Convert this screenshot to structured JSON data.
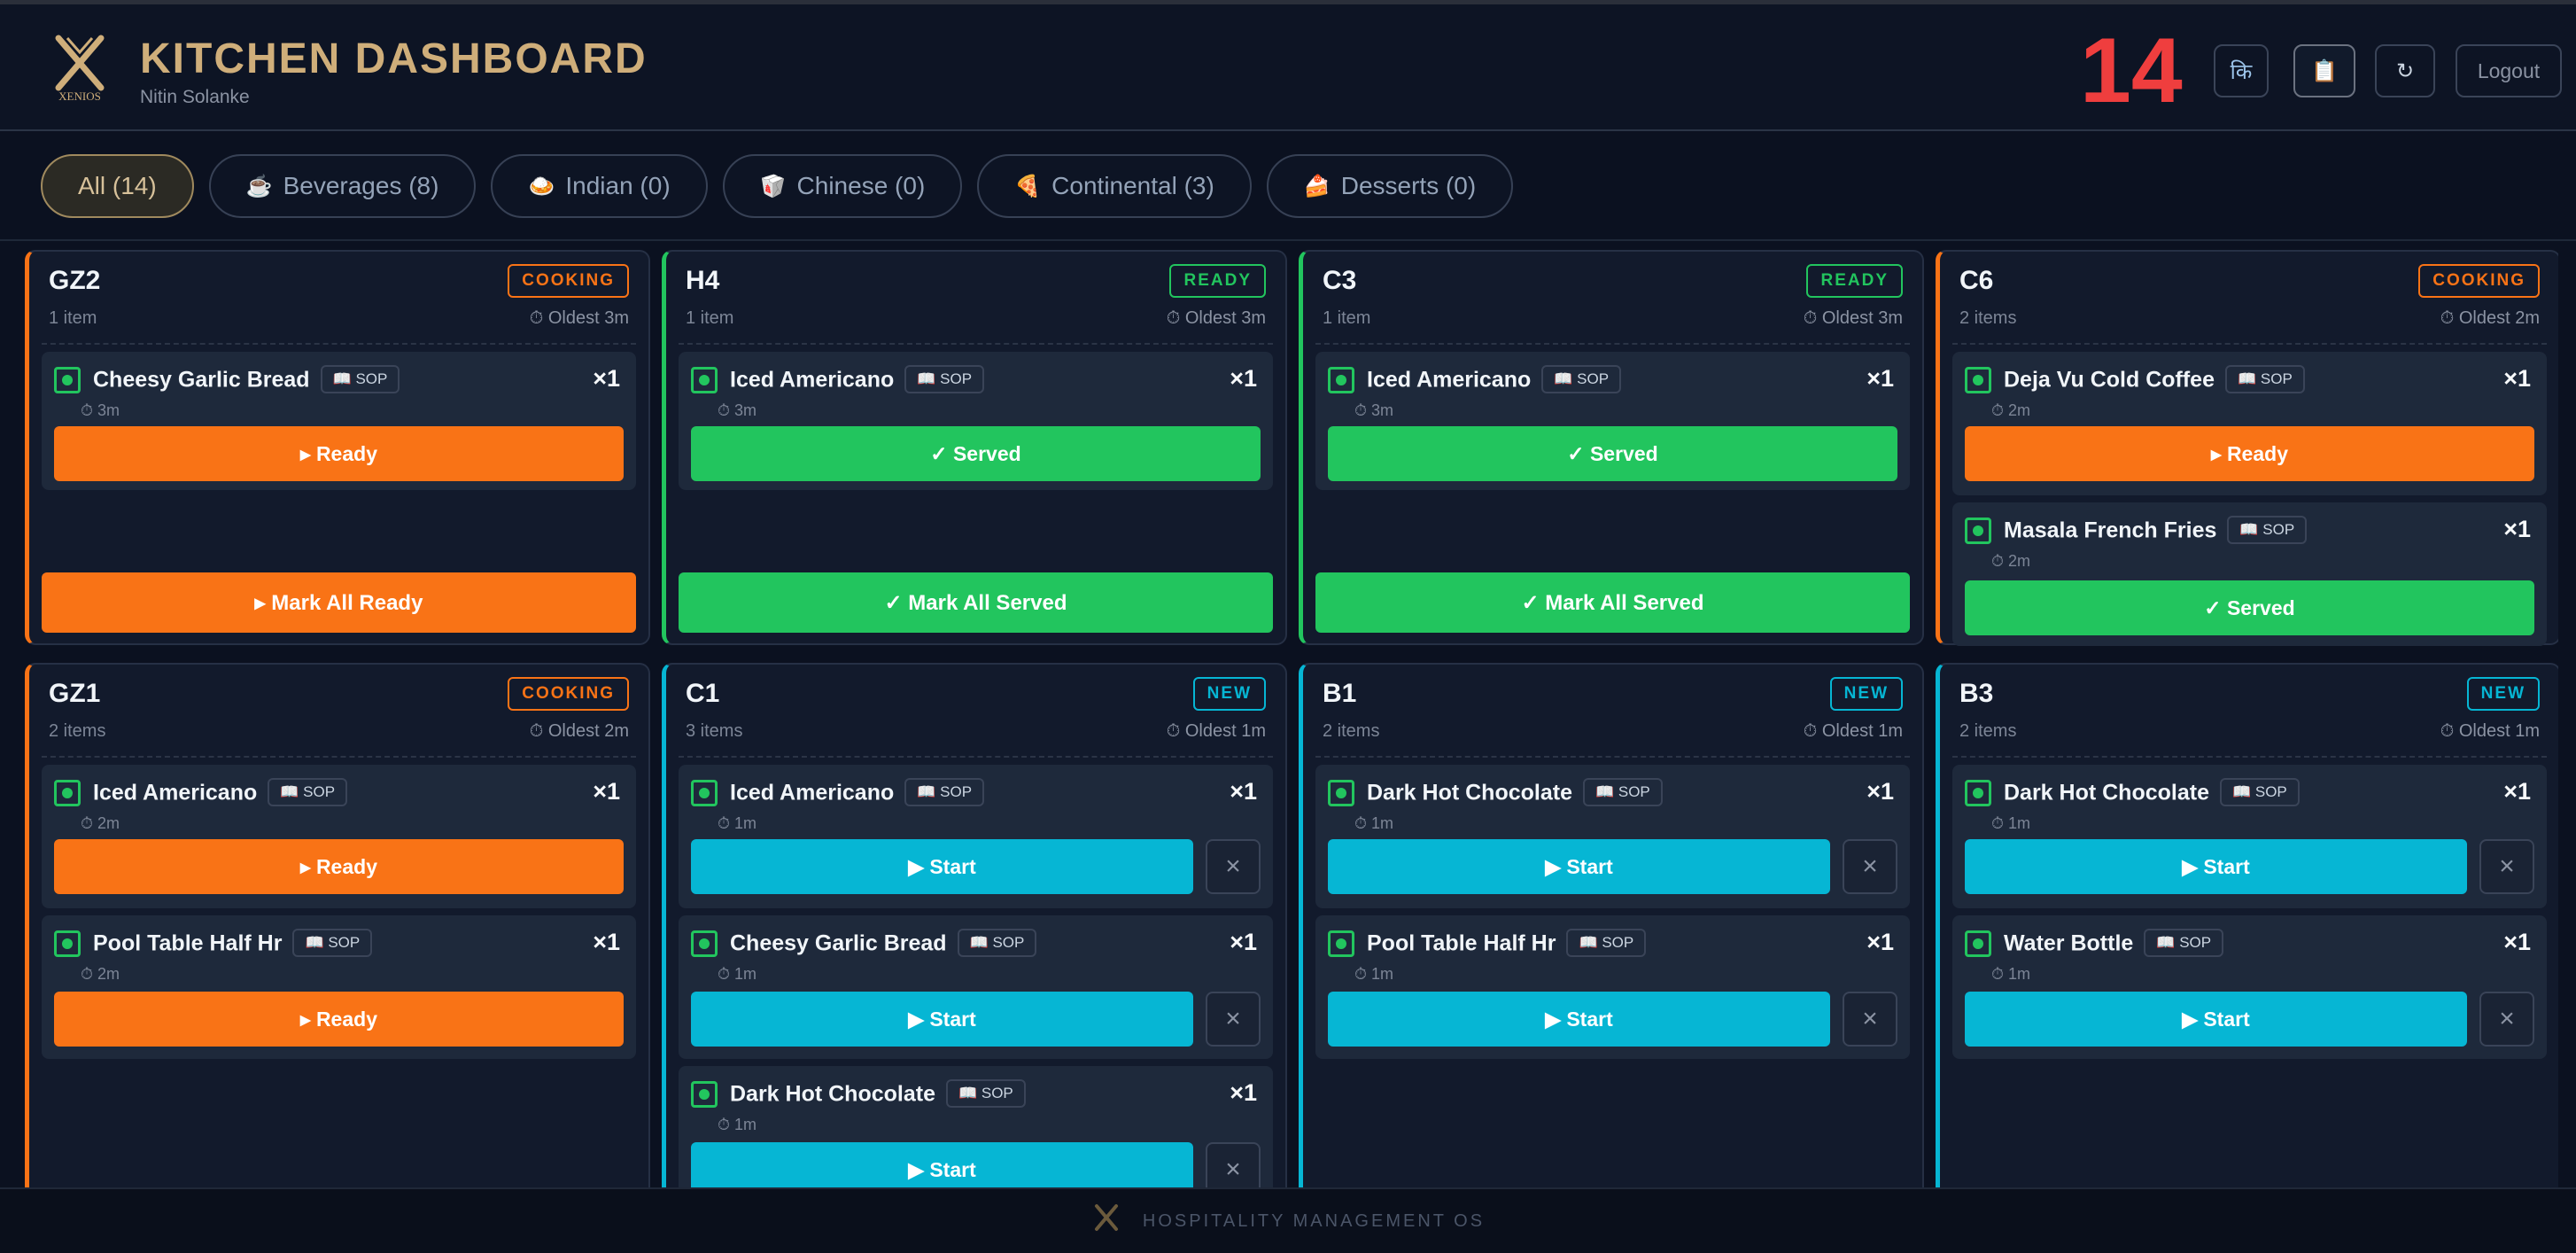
{
  "header": {
    "logo_text": "XENIOS",
    "title": "KITCHEN DASHBOARD",
    "user": "Nitin Solanke",
    "order_count": "14",
    "lang_icon": "कि",
    "clipboard_icon": "📋",
    "refresh_icon": "↻",
    "logout_label": "Logout"
  },
  "filters": [
    {
      "icon": "",
      "label": "All (14)"
    },
    {
      "icon": "☕",
      "label": "Beverages (8)"
    },
    {
      "icon": "🍛",
      "label": "Indian (0)"
    },
    {
      "icon": "🥡",
      "label": "Chinese (0)"
    },
    {
      "icon": "🍕",
      "label": "Continental (3)"
    },
    {
      "icon": "🍰",
      "label": "Desserts (0)"
    }
  ],
  "common": {
    "sop_label": "📖 SOP",
    "ready_label": "▸ Ready",
    "served_label": "✓ Served",
    "start_label": "▶ Start",
    "close_icon": "×",
    "mark_all_ready": "▸ Mark All Ready",
    "mark_all_served": "✓ Mark All Served"
  },
  "orders": [
    {
      "table": "GZ2",
      "status": "COOKING",
      "count": "1 item",
      "oldest": "⏱ Oldest 3m",
      "items": [
        {
          "name": "Cheesy Garlic Bread",
          "qty": "×1",
          "age": "⏱ 3m"
        }
      ]
    },
    {
      "table": "H4",
      "status": "READY",
      "count": "1 item",
      "oldest": "⏱ Oldest 3m",
      "items": [
        {
          "name": "Iced Americano",
          "qty": "×1",
          "age": "⏱ 3m"
        }
      ]
    },
    {
      "table": "C3",
      "status": "READY",
      "count": "1 item",
      "oldest": "⏱ Oldest 3m",
      "items": [
        {
          "name": "Iced Americano",
          "qty": "×1",
          "age": "⏱ 3m"
        }
      ]
    },
    {
      "table": "C6",
      "status": "COOKING",
      "count": "2 items",
      "oldest": "⏱ Oldest 2m",
      "items": [
        {
          "name": "Deja Vu Cold Coffee",
          "qty": "×1",
          "age": "⏱ 2m"
        },
        {
          "name": "Masala French Fries",
          "qty": "×1",
          "age": "⏱ 2m"
        }
      ]
    },
    {
      "table": "GZ1",
      "status": "COOKING",
      "count": "2 items",
      "oldest": "⏱ Oldest 2m",
      "items": [
        {
          "name": "Iced Americano",
          "qty": "×1",
          "age": "⏱ 2m"
        },
        {
          "name": "Pool Table Half Hr",
          "qty": "×1",
          "age": "⏱ 2m"
        }
      ]
    },
    {
      "table": "C1",
      "status": "NEW",
      "count": "3 items",
      "oldest": "⏱ Oldest 1m",
      "items": [
        {
          "name": "Iced Americano",
          "qty": "×1",
          "age": "⏱ 1m"
        },
        {
          "name": "Cheesy Garlic Bread",
          "qty": "×1",
          "age": "⏱ 1m"
        },
        {
          "name": "Dark Hot Chocolate",
          "qty": "×1",
          "age": "⏱ 1m"
        }
      ]
    },
    {
      "table": "B1",
      "status": "NEW",
      "count": "2 items",
      "oldest": "⏱ Oldest 1m",
      "items": [
        {
          "name": "Dark Hot Chocolate",
          "qty": "×1",
          "age": "⏱ 1m"
        },
        {
          "name": "Pool Table Half Hr",
          "qty": "×1",
          "age": "⏱ 1m"
        }
      ]
    },
    {
      "table": "B3",
      "status": "NEW",
      "count": "2 items",
      "oldest": "⏱ Oldest 1m",
      "items": [
        {
          "name": "Dark Hot Chocolate",
          "qty": "×1",
          "age": "⏱ 1m"
        },
        {
          "name": "Water Bottle",
          "qty": "×1",
          "age": "⏱ 1m"
        }
      ]
    }
  ],
  "footer": {
    "text": "HOSPITALITY MANAGEMENT OS"
  },
  "colors": {
    "cooking": "#f97316",
    "ready": "#22c55e",
    "new": "#06b6d4",
    "brand": "#cfae7a",
    "count": "#ef3e3e"
  }
}
